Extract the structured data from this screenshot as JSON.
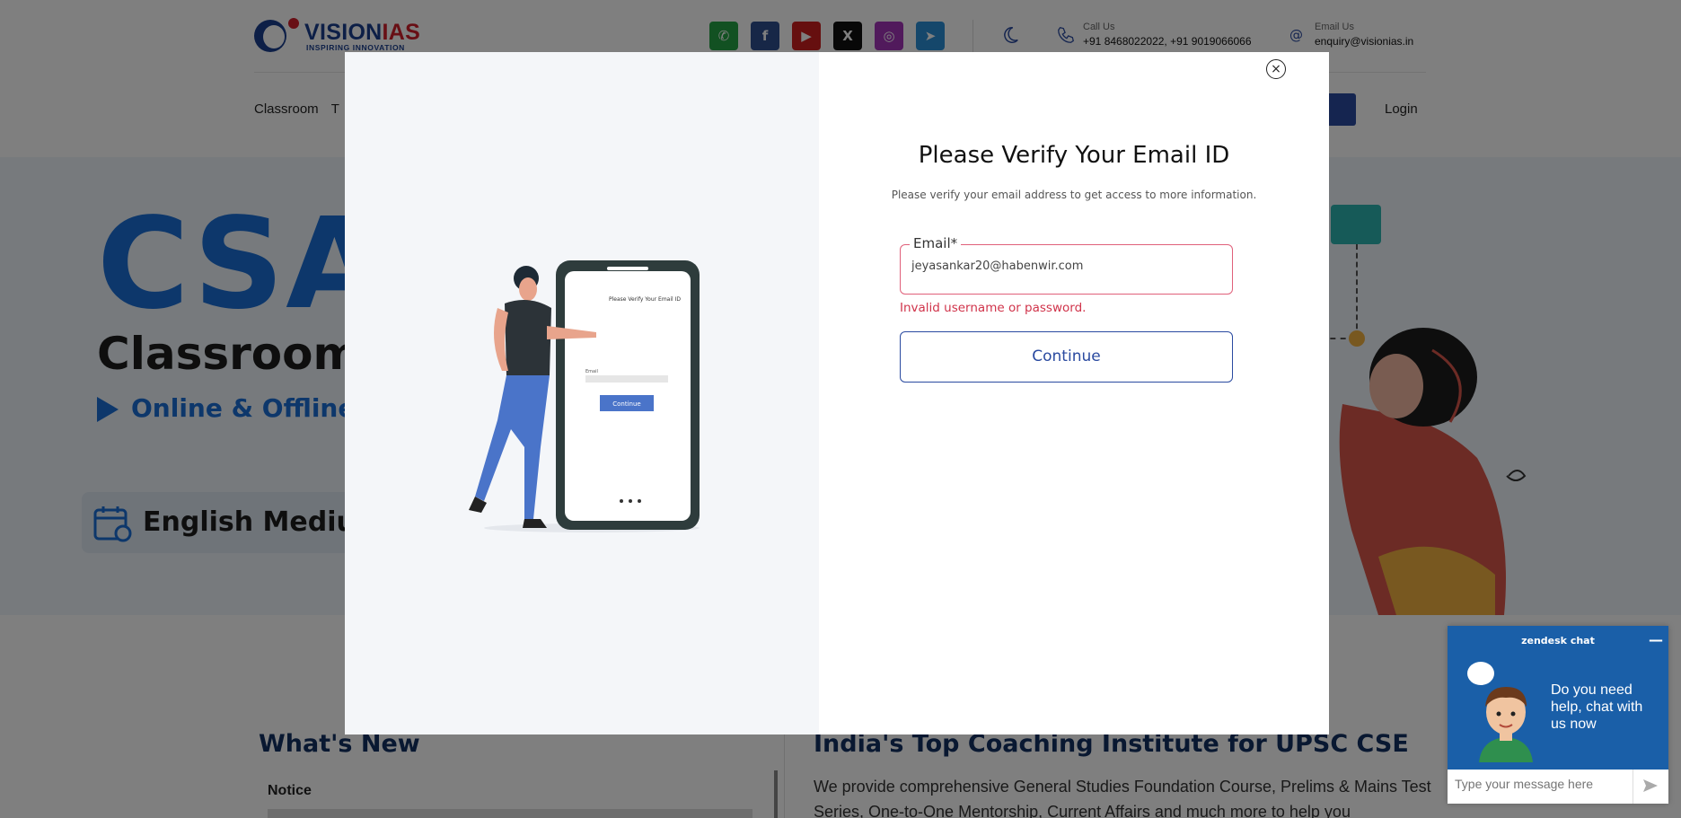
{
  "header": {
    "logo_text_a": "VISION",
    "logo_text_b": "IAS",
    "logo_tagline": "INSPIRING INNOVATION",
    "socials": [
      {
        "name": "whatsapp-icon",
        "color": "#25a244",
        "glyph": "✆"
      },
      {
        "name": "facebook-icon",
        "color": "#2e4f8f",
        "glyph": "f"
      },
      {
        "name": "youtube-icon",
        "color": "#cc1f1f",
        "glyph": "▶"
      },
      {
        "name": "x-icon",
        "color": "#111111",
        "glyph": "X"
      },
      {
        "name": "instagram-icon",
        "color": "#a234b8",
        "glyph": "◎"
      },
      {
        "name": "telegram-icon",
        "color": "#2a8fd6",
        "glyph": "➤"
      }
    ],
    "call_label": "Call Us",
    "call_value": "+91 8468022022, +91 9019066066",
    "email_label": "Email Us",
    "email_value": "enquiry@visionias.in",
    "nav_items": [
      "Classroom",
      "T"
    ],
    "login_label": "Login"
  },
  "hero": {
    "big_text": "CSA",
    "classroom_text": "Classroom I",
    "online_text": "Online & Offline",
    "online_suffix": "c",
    "medium_text": "English Mediun"
  },
  "lower": {
    "whats_new": "What's New",
    "notice": "Notice",
    "india_title": "India's Top Coaching Institute for UPSC CSE",
    "provide_text": "We provide comprehensive General Studies Foundation Course, Prelims & Mains Test Series, One-to-One Mentorship, Current Affairs and much more to help you"
  },
  "modal": {
    "title": "Please Verify Your Email ID",
    "subtitle": "Please verify your email address to get access to more information.",
    "email_label": "Email*",
    "email_value": "jeyasankar20@habenwir.com",
    "error": "Invalid username or password.",
    "continue_label": "Continue",
    "close_glyph": "×",
    "phone_title": "Please Verify Your Email ID",
    "phone_email_label": "Email",
    "phone_button": "Continue"
  },
  "zendesk": {
    "header": "zendesk chat",
    "minimize": "—",
    "message": "Do you need help, chat with us now",
    "input_placeholder": "Type your message here"
  }
}
